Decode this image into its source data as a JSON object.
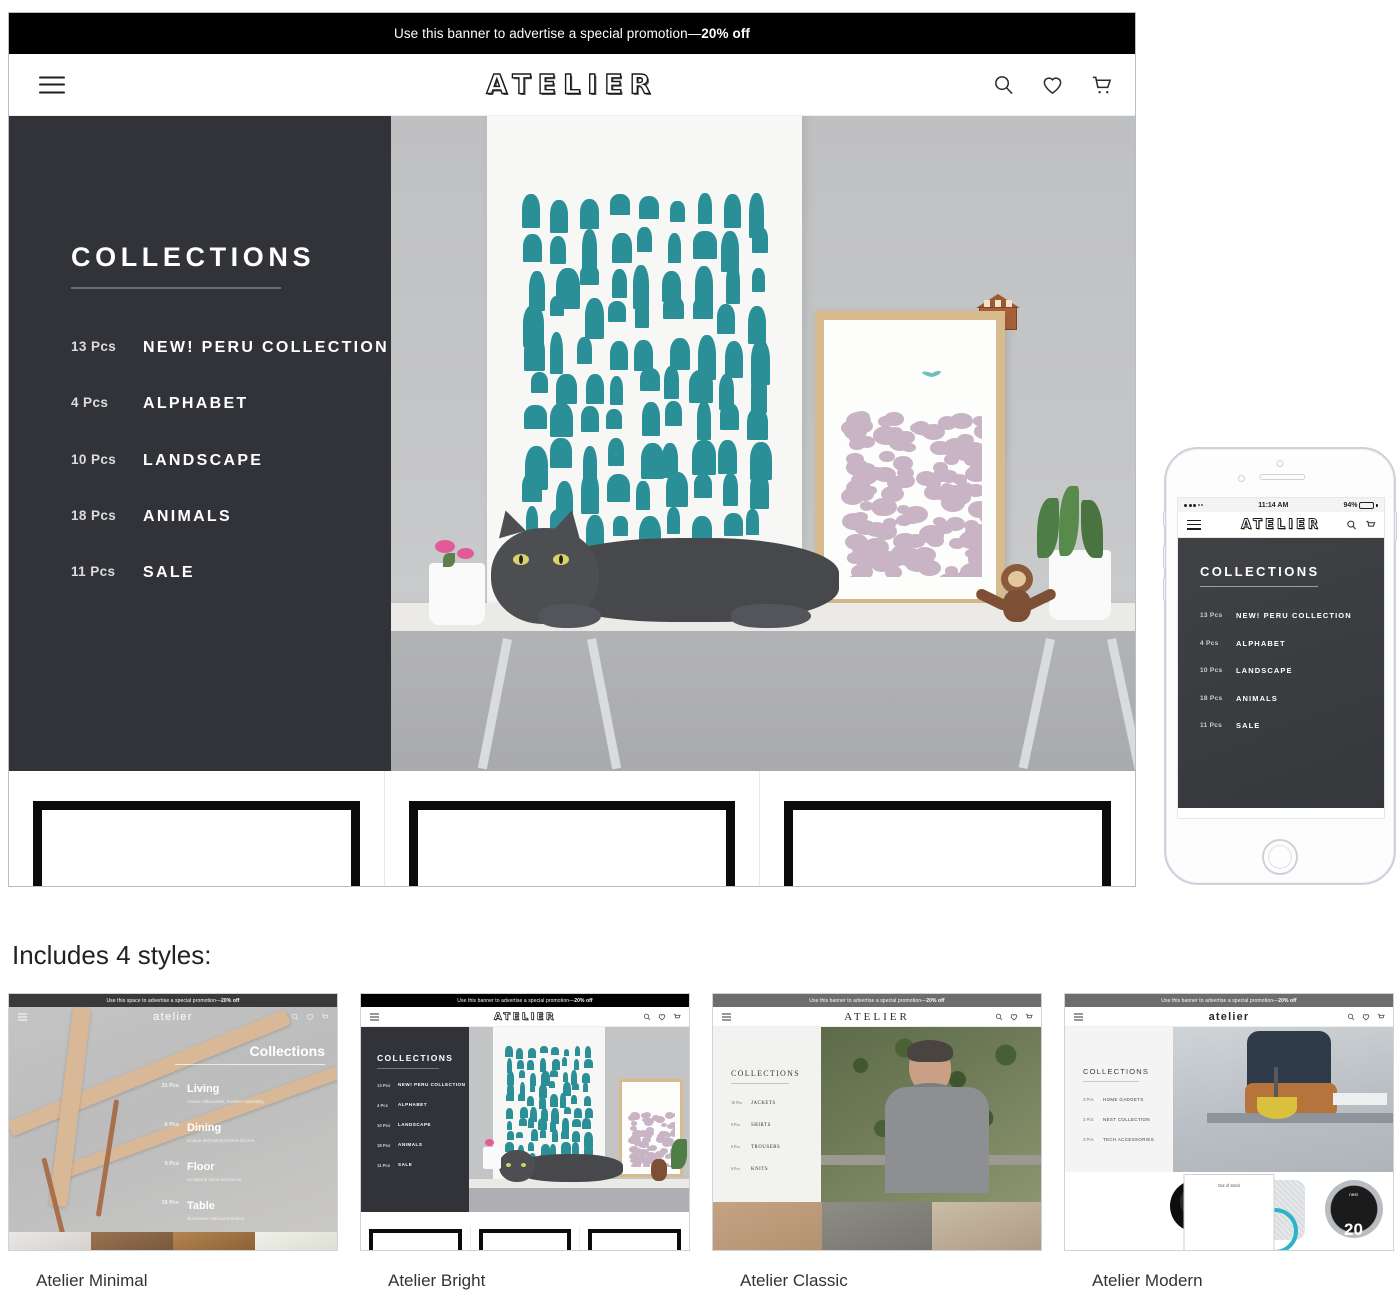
{
  "desktop": {
    "promo_banner": {
      "text": "Use this banner to advertise a special promotion—",
      "bold": "20% off"
    },
    "header": {
      "menu_icon": "hamburger-icon",
      "logo": "ATELIER",
      "icons": [
        "search-icon",
        "heart-icon",
        "cart-icon"
      ]
    },
    "hero": {
      "collections_title": "COLLECTIONS",
      "items": [
        {
          "pcs": "13 Pcs",
          "name": "NEW! PERU COLLECTION"
        },
        {
          "pcs": "4 Pcs",
          "name": "ALPHABET"
        },
        {
          "pcs": "10 Pcs",
          "name": "LANDSCAPE"
        },
        {
          "pcs": "18 Pcs",
          "name": "ANIMALS"
        },
        {
          "pcs": "11 Pcs",
          "name": "SALE"
        }
      ]
    }
  },
  "phone": {
    "status": {
      "time": "11:14 AM",
      "battery": "94%"
    },
    "header": {
      "logo": "ATELIER"
    },
    "hero": {
      "collections_title": "COLLECTIONS",
      "items": [
        {
          "pcs": "13 Pcs",
          "name": "NEW! PERU COLLECTION"
        },
        {
          "pcs": "4 Pcs",
          "name": "ALPHABET"
        },
        {
          "pcs": "10 Pcs",
          "name": "LANDSCAPE"
        },
        {
          "pcs": "18 Pcs",
          "name": "ANIMALS"
        },
        {
          "pcs": "11 Pcs",
          "name": "SALE"
        }
      ]
    }
  },
  "styles": {
    "heading": "Includes 4 styles:",
    "cards": [
      {
        "caption": "Atelier Minimal",
        "logo": "atelier",
        "banner_text": "Use this space to advertise a special promotion—",
        "banner_bold": "20% off",
        "banner_color": "#3a3a3a",
        "collections_title": "Collections",
        "items": [
          {
            "pcs": "31 Pcs",
            "name": "Living",
            "desc": "Classic silhouettes, modern materiality."
          },
          {
            "pcs": "6 Pcs",
            "name": "Dining",
            "desc": "Unique and tasteful home fixtures."
          },
          {
            "pcs": "9 Pcs",
            "name": "Floor",
            "desc": "Sculptural stand-out pieces."
          },
          {
            "pcs": "15 Pcs",
            "name": "Table",
            "desc": "Illumination without limitation."
          }
        ]
      },
      {
        "caption": "Atelier Bright",
        "logo": "ATELIER",
        "banner_text": "Use this banner to advertise a special promotion—",
        "banner_bold": "20% off",
        "banner_color": "#000000",
        "collections_title": "COLLECTIONS",
        "items": [
          {
            "pcs": "13 Pcs",
            "name": "NEW! PERU COLLECTION"
          },
          {
            "pcs": "4 Pcs",
            "name": "ALPHABET"
          },
          {
            "pcs": "10 Pcs",
            "name": "LANDSCAPE"
          },
          {
            "pcs": "18 Pcs",
            "name": "ANIMALS"
          },
          {
            "pcs": "11 Pcs",
            "name": "SALE"
          }
        ]
      },
      {
        "caption": "Atelier Classic",
        "logo": "ATELIER",
        "banner_text": "Use this banner to advertise a special promotion—",
        "banner_bold": "20% off",
        "banner_color": "#6d6d6d",
        "collections_title": "COLLECTIONS",
        "items": [
          {
            "pcs": "10 Pcs",
            "name": "JACKETS"
          },
          {
            "pcs": "9 Pcs",
            "name": "SHIRTS"
          },
          {
            "pcs": "6 Pcs",
            "name": "TROUSERS"
          },
          {
            "pcs": "6 Pcs",
            "name": "KNITS"
          }
        ]
      },
      {
        "caption": "Atelier Modern",
        "logo": "atelier",
        "banner_text": "Use this banner to advertise a special promotion—",
        "banner_bold": "20% off",
        "banner_color": "#6d6d6d",
        "collections_title": "COLLECTIONS",
        "items": [
          {
            "pcs": "3 Pcs",
            "name": "HOME GADGETS"
          },
          {
            "pcs": "3 Pcs",
            "name": "NEST COLLECTION"
          },
          {
            "pcs": "3 Pcs",
            "name": "TECH ACCESSORIES"
          }
        ],
        "badge": "Out of stock",
        "thermostat_brand": "nest",
        "thermostat_value": "20"
      }
    ]
  },
  "colors": {
    "sidebar_dark": "#313338",
    "banner_black": "#000000",
    "teal_print": "#2a8f96",
    "pink_print": "#c9b4c6",
    "wood_frame": "#d7bb8c"
  }
}
